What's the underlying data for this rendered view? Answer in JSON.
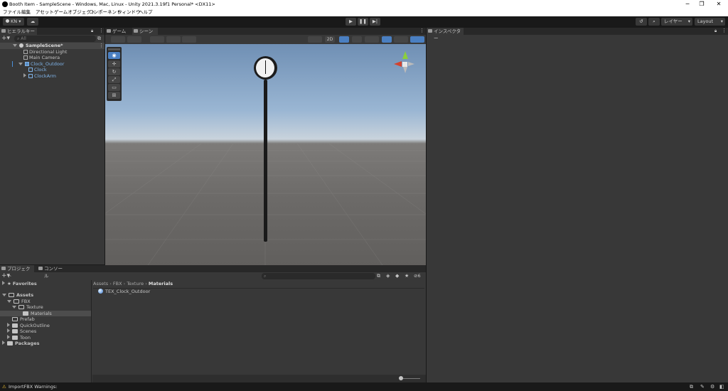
{
  "window": {
    "title": "Booth Item - SampleScene - Windows, Mac, Linux - Unity 2021.3.19f1 Personal* <DX11>",
    "controls": [
      "─",
      "❐",
      "✕"
    ]
  },
  "menu": [
    "ファイル",
    "編集",
    "アセット",
    "ゲームオブジェクト",
    "コンポーネント",
    "ウィンドウ",
    "ヘルプ"
  ],
  "toolbar": {
    "account": "KN",
    "layers": "レイヤー",
    "layout": "Layout"
  },
  "hierarchy": {
    "tab": "ヒエラルキー",
    "search_placeholder": "All",
    "scene": "SampleScene*",
    "items": [
      {
        "label": "Directional Light"
      },
      {
        "label": "Main Camera"
      },
      {
        "label": "Clock_Outdoor"
      },
      {
        "label": "Clock"
      },
      {
        "label": "ClockArm"
      }
    ]
  },
  "scene_view": {
    "tabs": [
      "ゲーム",
      "シーン"
    ],
    "mode_2d": "2D",
    "sky_color": "#9ab6d3",
    "ground_color": "#6c6a68"
  },
  "inspector": {
    "tab": "インスペクター"
  },
  "project": {
    "tabs": [
      "プロジェクト",
      "コンソール"
    ],
    "tree": {
      "favorites": "Favorites",
      "assets": "Assets",
      "fbx": "FBX",
      "texture": "Texture",
      "materials": "Materials",
      "prefab": "Prefab",
      "quickoutline": "QuickOutline",
      "scenes": "Scenes",
      "toon": "Toon",
      "packages": "Packages"
    },
    "breadcrumb": [
      "Assets",
      "FBX",
      "Texture",
      "Materials"
    ],
    "files": [
      {
        "label": "TEX_Clock_Outdoor"
      }
    ],
    "hidden_count": "6"
  },
  "status": {
    "message": "ImportFBX Warnings:",
    "accent": "#f4c430"
  }
}
